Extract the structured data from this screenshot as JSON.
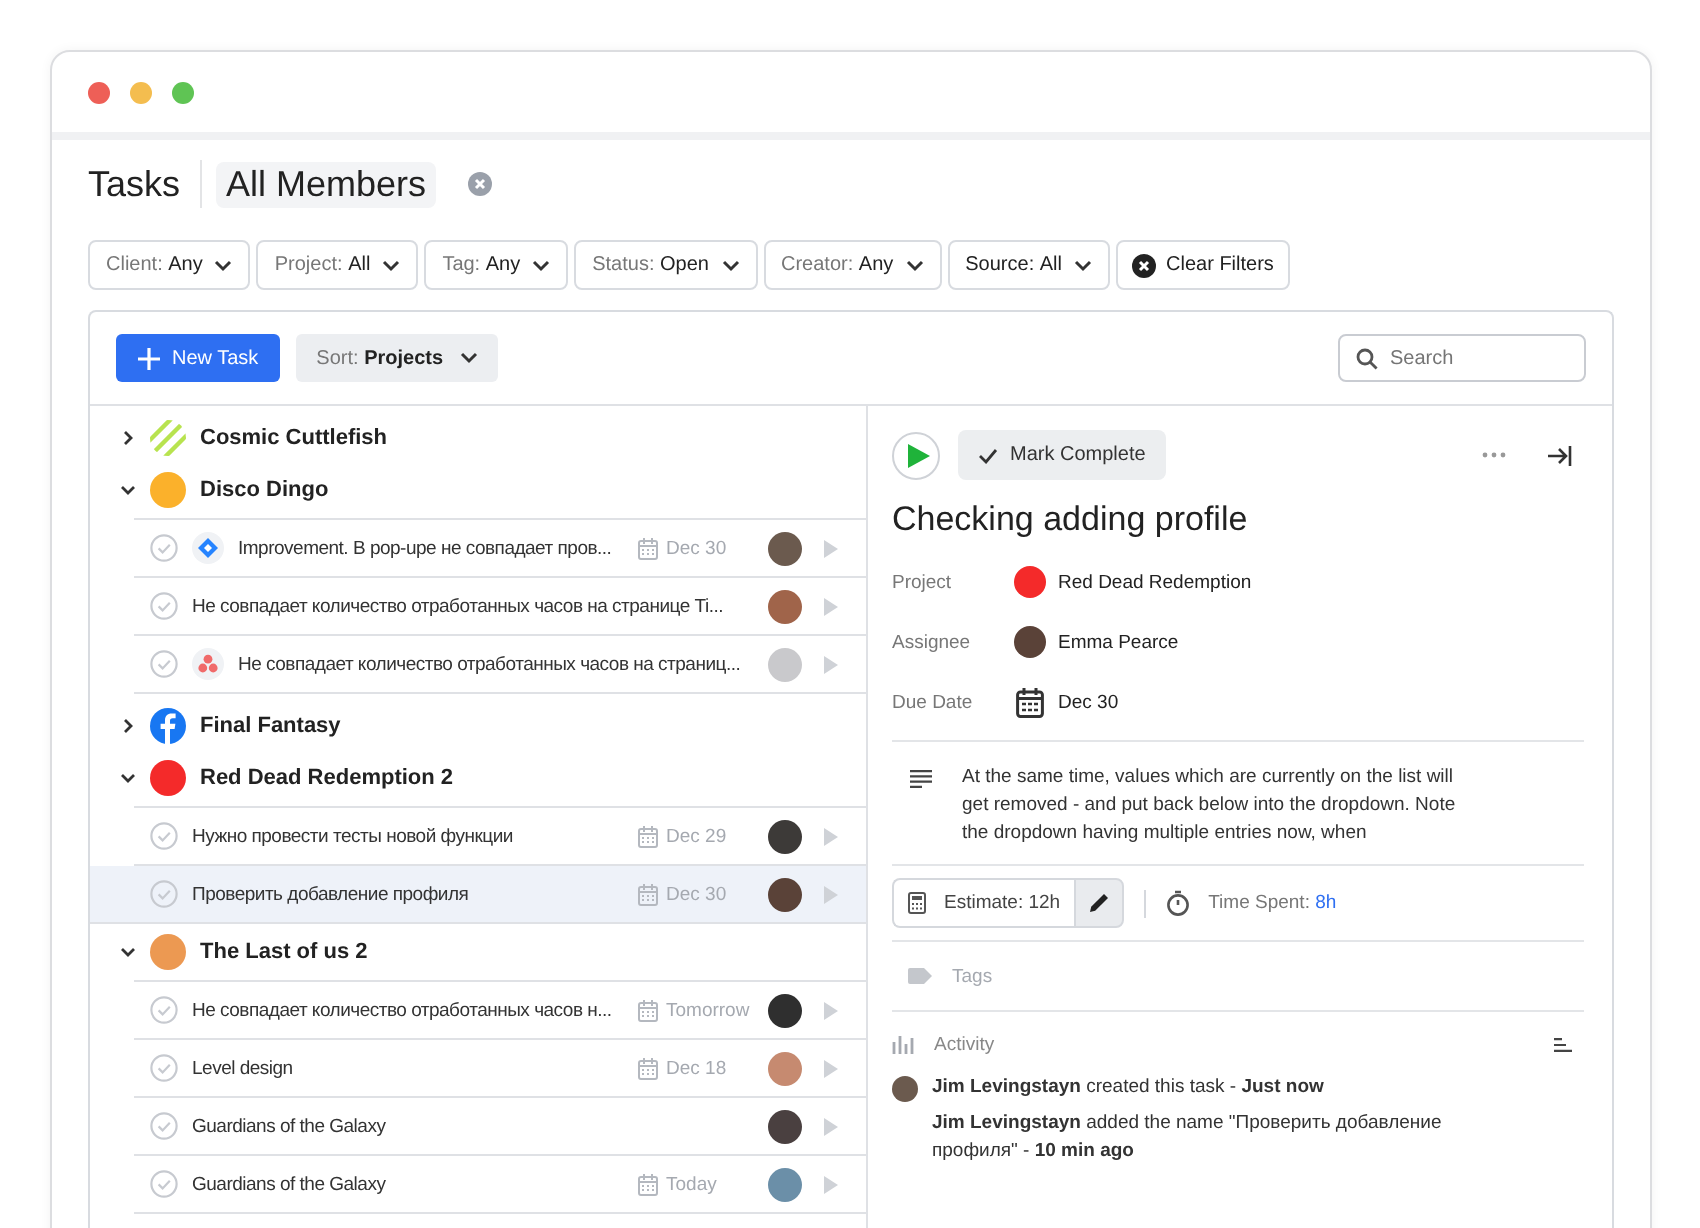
{
  "header": {
    "title": "Tasks",
    "view": "All Members"
  },
  "filters": [
    {
      "label": "Client:",
      "value": "Any",
      "active": false
    },
    {
      "label": "Project:",
      "value": "All",
      "active": false
    },
    {
      "label": "Tag:",
      "value": "Any",
      "active": false
    },
    {
      "label": "Status:",
      "value": "Open",
      "active": false
    },
    {
      "label": "Creator:",
      "value": "Any",
      "active": false
    },
    {
      "label": "Source:",
      "value": "All",
      "active": true
    }
  ],
  "clear_filters": "Clear Filters",
  "toolbar": {
    "new_task": "New Task",
    "sort": {
      "label": "Sort:",
      "value": "Projects"
    },
    "search": {
      "placeholder": "Search"
    }
  },
  "projects": [
    {
      "name": "Cosmic Cuttlefish",
      "kind": "striped",
      "color": "#b8e34f",
      "expanded": false
    },
    {
      "name": "Disco Dingo",
      "kind": "dot",
      "color": "#fbb12b",
      "expanded": true,
      "tasks": [
        {
          "title": "Improvement. В pop-upe не совпадает пров...",
          "kind": "diamond",
          "due": "Dec 30",
          "selected": false
        },
        {
          "title": "Не совпадает количество отработанных часов на странице Ti...",
          "kind": "plain",
          "selected": false
        },
        {
          "title": "Не совпадает количество отработанных часов на страниц...",
          "kind": "dots",
          "selected": false
        }
      ]
    },
    {
      "name": "Final Fantasy",
      "kind": "facebook",
      "color": "#1877f2",
      "expanded": false
    },
    {
      "name": "Red Dead Redemption 2",
      "kind": "dot",
      "color": "#f42a2a",
      "expanded": true,
      "tasks": [
        {
          "title": "Нужно провести тесты новой функции",
          "due": "Dec 29",
          "selected": false
        },
        {
          "title": "Проверить добавление профиля",
          "due": "Dec 30",
          "selected": true
        }
      ]
    },
    {
      "name": "The Last of us 2",
      "kind": "dot",
      "color": "#ec9952",
      "expanded": true,
      "tasks": [
        {
          "title": "Не совпадает количество отработанных часов  н...",
          "due": "Tomorrow",
          "selected": false
        },
        {
          "title": "Level design",
          "due": "Dec 18",
          "selected": false
        },
        {
          "title": "Guardians of the Galaxy",
          "selected": false
        },
        {
          "title": "Guardians of the Galaxy",
          "due": "Today",
          "selected": false
        }
      ]
    }
  ],
  "detail": {
    "mark_complete": "Mark Complete",
    "title": "Checking adding profile",
    "fields": [
      {
        "label": "Project",
        "kind": "project",
        "value": "Red Dead Redemption",
        "color": "#f42a2a"
      },
      {
        "label": "Assignee",
        "kind": "person",
        "value": "Emma Pearce"
      },
      {
        "label": "Due Date",
        "kind": "date",
        "value": "Dec 30"
      }
    ],
    "description": "At the same time, values which are currently on the list will get removed - and put back below into the dropdown. Note the dropdown having multiple entries now, when",
    "estimate": "Estimate: 12h",
    "time_spent": {
      "label": "Time Spent:",
      "value": "8h"
    },
    "tags": {
      "placeholder": "Tags"
    },
    "activity": {
      "title": "Activity",
      "entries": [
        {
          "text": "**Jim Levingstayn** created this task - **Just now**",
          "avatar": true
        },
        {
          "text": "**Jim Levingstayn** added the name \"Проверить добавление профиля\" - **10 min ago**",
          "avatar": false
        }
      ]
    }
  }
}
